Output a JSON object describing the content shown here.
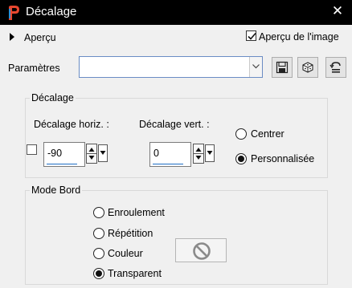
{
  "window": {
    "title": "Décalage",
    "close_glyph": "✕"
  },
  "preview": {
    "label": "Aperçu",
    "image_label": "Aperçu de l'image",
    "image_checked": true
  },
  "presets": {
    "label": "Paramètres",
    "value": "",
    "buttons": [
      "save-icon",
      "randomize-icon",
      "reset-icon"
    ]
  },
  "offset": {
    "group_title": "Décalage",
    "horizontal_label": "Décalage horiz. :",
    "horizontal_value": "-90",
    "vertical_label": "Décalage vert. :",
    "vertical_value": "0",
    "center_label": "Centrer",
    "custom_label": "Personnalisée",
    "selected": "Personnalisée"
  },
  "edge_mode": {
    "group_title": "Mode Bord",
    "options": [
      "Enroulement",
      "Répétition",
      "Couleur",
      "Transparent"
    ],
    "selected": "Transparent"
  },
  "colors": {
    "accent": "#1f6fc5",
    "titlebar": "#000000"
  }
}
